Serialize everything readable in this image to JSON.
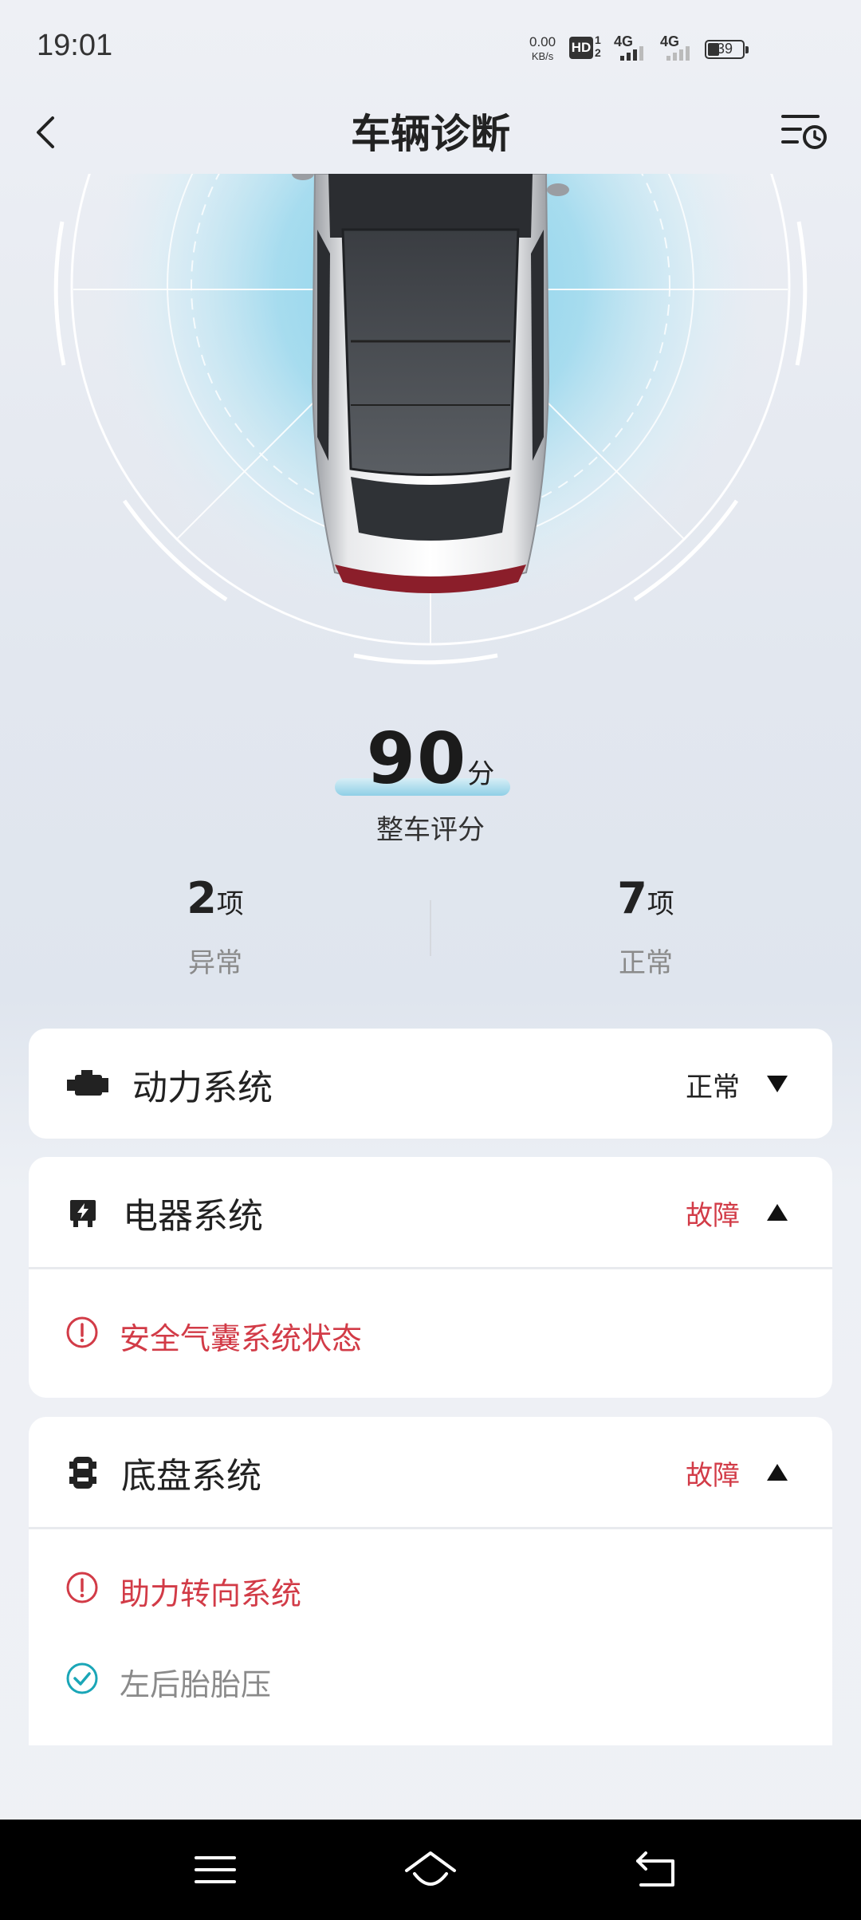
{
  "status_bar": {
    "time": "19:01",
    "net_speed_value": "0.00",
    "net_speed_unit": "KB/s",
    "hd_label": "HD",
    "hd_sub_top": "1",
    "hd_sub_bottom": "2",
    "signal1_label": "4G",
    "signal2_label": "4G",
    "battery_level": "39"
  },
  "header": {
    "title": "车辆诊断",
    "back_icon": "chevron-left-icon",
    "history_icon": "history-list-icon"
  },
  "score": {
    "value": "90",
    "unit": "分",
    "label": "整车评分"
  },
  "stats": {
    "abnormal": {
      "count": "2",
      "unit": "项",
      "label": "异常"
    },
    "normal": {
      "count": "7",
      "unit": "项",
      "label": "正常"
    }
  },
  "systems": [
    {
      "name": "动力系统",
      "status": "正常",
      "expanded": false,
      "icon": "engine-icon",
      "items": []
    },
    {
      "name": "电器系统",
      "status": "故障",
      "expanded": true,
      "icon": "electrical-icon",
      "items": [
        {
          "label": "安全气囊系统状态",
          "state": "fault"
        }
      ]
    },
    {
      "name": "底盘系统",
      "status": "故障",
      "expanded": true,
      "icon": "chassis-icon",
      "items": [
        {
          "label": "助力转向系统",
          "state": "fault"
        },
        {
          "label": "左后胎胎压",
          "state": "ok"
        }
      ]
    }
  ],
  "colors": {
    "fault": "#d23b47",
    "ok_check": "#1aa6b7",
    "normal_text": "#222222",
    "accent_glow": "#8fd4ea"
  },
  "navbar": {
    "menu_icon": "menu-icon",
    "home_icon": "home-icon",
    "back_icon": "back-icon"
  }
}
